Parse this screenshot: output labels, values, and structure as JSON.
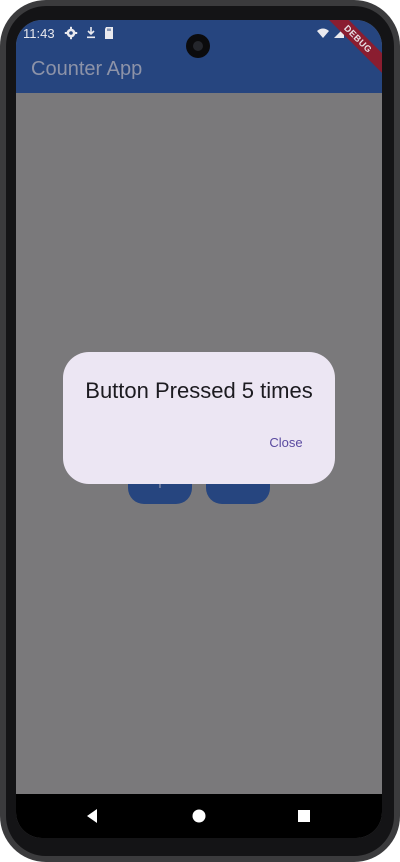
{
  "status_bar": {
    "time": "11:43",
    "icons": [
      "settings-icon",
      "download-icon",
      "sd-card-icon",
      "wifi-icon",
      "signal-icon",
      "battery-icon"
    ]
  },
  "app_bar": {
    "title": "Counter App",
    "color": "#26457f"
  },
  "debug_banner": "DEBUG",
  "background_buttons": [
    {
      "label": "+",
      "icon": "plus-icon"
    },
    {
      "label": "−",
      "icon": "minus-icon"
    }
  ],
  "dialog": {
    "message": "Button Pressed 5 times",
    "close_label": "Close",
    "accent": "#5a4aa0",
    "surface": "#ece6f3"
  },
  "nav_bar": {
    "icons": [
      "back-icon",
      "home-icon",
      "recents-icon"
    ]
  },
  "scrim_color": "#7a797b"
}
